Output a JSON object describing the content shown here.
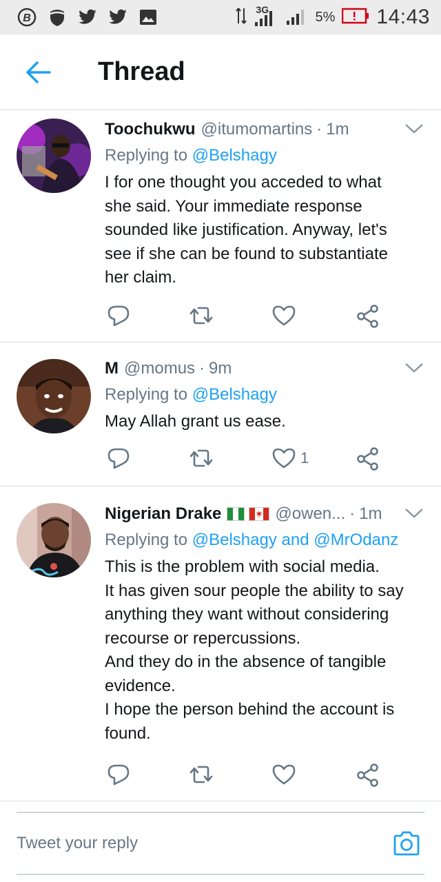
{
  "status_bar": {
    "network": "3G",
    "battery": "5%",
    "time": "14:43",
    "icons": [
      "b-circle-icon",
      "shield-icon",
      "twitter-icon",
      "twitter-icon",
      "image-icon"
    ]
  },
  "header": {
    "title": "Thread",
    "back_icon": "arrow-left-icon"
  },
  "colors": {
    "accent": "#1da1f2",
    "secondary_text": "#657786",
    "divider": "#d5dde3"
  },
  "tweets": [
    {
      "name": "Toochukwu",
      "handle": "@itumomartins",
      "time": "1m",
      "replying_prefix": "Replying to",
      "replying_to": "@Belshagy",
      "lines": [
        "I for one thought you acceded to what",
        "she said. Your immediate response",
        "sounded like justification. Anyway, let's",
        "see if she can be found to substantiate",
        "her claim."
      ],
      "likes": ""
    },
    {
      "name": "M",
      "handle": "@momus",
      "time": "9m",
      "replying_prefix": "Replying to",
      "replying_to": "@Belshagy",
      "lines": [
        "May Allah grant us ease."
      ],
      "likes": "1"
    },
    {
      "name": "Nigerian Drake",
      "handle": "@owen...",
      "time": "1m",
      "replying_prefix": "Replying to",
      "replying_to": "@Belshagy",
      "replying_and": "and",
      "replying_to_2": "@MrOdanz",
      "lines": [
        "This is the problem with social media.",
        "It has given sour people the ability to say",
        "anything they want without considering",
        "recourse or repercussions.",
        "And they do in the absence of tangible",
        "evidence.",
        "I hope the person behind the account is",
        "found."
      ],
      "likes": ""
    }
  ],
  "composer": {
    "placeholder": "Tweet your reply",
    "camera_icon": "camera-icon"
  }
}
